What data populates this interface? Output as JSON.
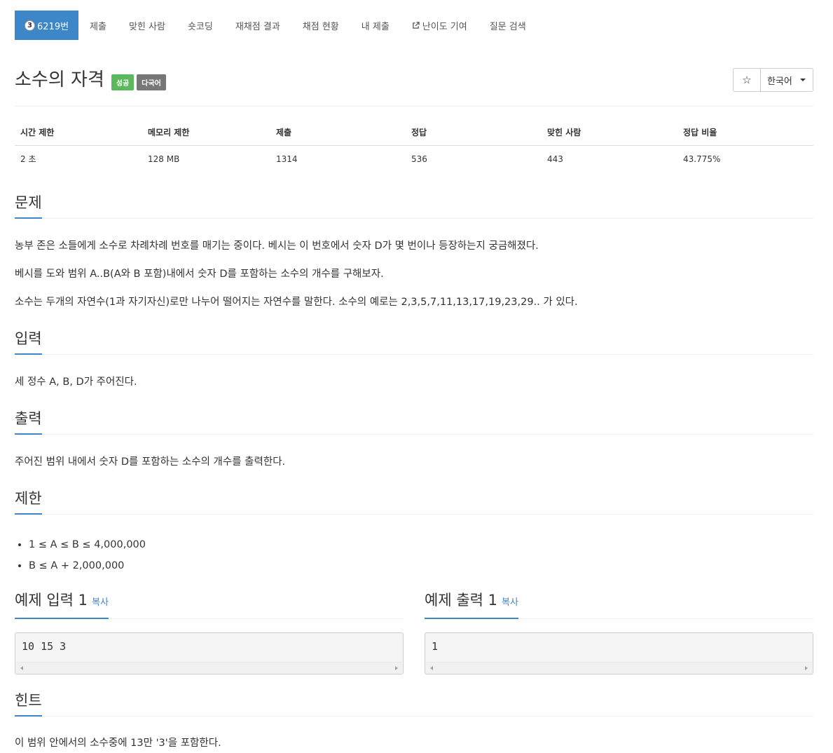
{
  "nav": {
    "problem_tier": "3",
    "problem_label": "6219번",
    "items": [
      "제출",
      "맞힌 사람",
      "숏코딩",
      "재채점 결과",
      "채점 현황",
      "내 제출",
      "난이도 기여",
      "질문 검색"
    ]
  },
  "title": {
    "text": "소수의 자격",
    "badge_success": "성공",
    "badge_lang": "다국어"
  },
  "controls": {
    "star": "☆",
    "language": "한국어"
  },
  "info": {
    "headers": [
      "시간 제한",
      "메모리 제한",
      "제출",
      "정답",
      "맞힌 사람",
      "정답 비율"
    ],
    "values": [
      "2 초",
      "128 MB",
      "1314",
      "536",
      "443",
      "43.775%"
    ]
  },
  "sections": {
    "problem_title": "문제",
    "problem_lines": [
      "농부 존은 소들에게 소수로 차례차례 번호를 매기는 중이다. 베시는 이 번호에서 숫자 D가 몇 번이나 등장하는지 궁금해졌다.",
      "베시를 도와 범위 A..B(A와 B 포함)내에서 숫자 D를 포함하는 소수의 개수를 구해보자.",
      "소수는 두개의 자연수(1과 자기자신)로만 나누어 떨어지는 자연수를 말한다. 소수의 예로는 2,3,5,7,11,13,17,19,23,29.. 가 있다."
    ],
    "input_title": "입력",
    "input_text": "세 정수 A, B, D가 주어진다.",
    "output_title": "출력",
    "output_text": "주어진 범위 내에서 숫자 D를 포함하는 소수의 개수를 출력한다.",
    "limit_title": "제한",
    "limits": [
      "1 ≤ A ≤ B ≤ 4,000,000",
      "B ≤ A + 2,000,000"
    ],
    "hint_title": "힌트",
    "hint_text": "이 범위 안에서의 소수중에 13만 '3'을 포함한다."
  },
  "samples": {
    "input_title": "예제 입력 1",
    "output_title": "예제 출력 1",
    "copy_label": "복사",
    "input_value": "10 15 3",
    "output_value": "1"
  }
}
